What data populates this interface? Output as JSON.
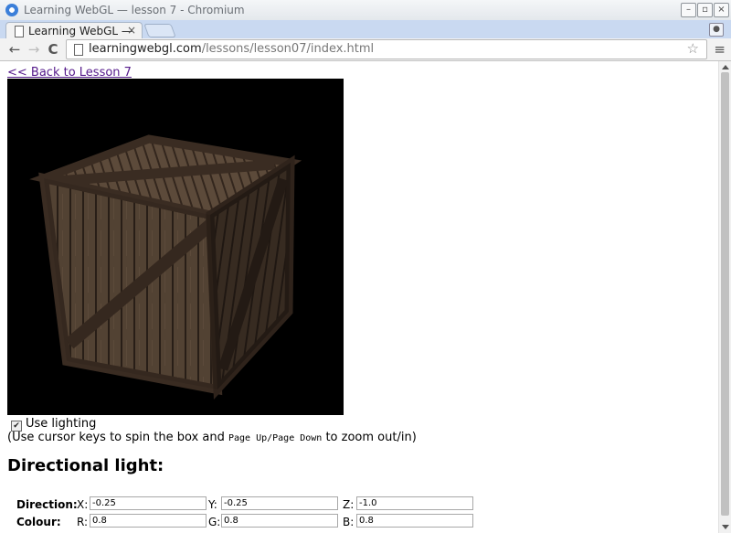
{
  "window": {
    "title": "Learning WebGL — lesson 7 - Chromium",
    "controls": {
      "minimize": "–",
      "maximize": "▫",
      "close": "×"
    }
  },
  "tab": {
    "title": "Learning WebGL — ",
    "close": "×"
  },
  "toolbar": {
    "back": "←",
    "forward": "→",
    "reload": "C",
    "url_host": "learningwebgl.com",
    "url_path": "/lessons/lesson07/index.html",
    "bookmark": "☆",
    "menu": "≡"
  },
  "page": {
    "back_link": "<< Back to Lesson 7",
    "use_lighting_label": "Use lighting",
    "use_lighting_checked": true,
    "hint_prefix": "(Use cursor keys to spin the box and ",
    "hint_keys": "Page Up/Page Down",
    "hint_suffix": " to zoom out/in)",
    "directional_heading": "Directional light:",
    "direction": {
      "label": "Direction:",
      "x_label": "X:",
      "x": "-0.25",
      "y_label": "Y:",
      "y": "-0.25",
      "z_label": "Z:",
      "z": "-1.0"
    },
    "colour": {
      "label": "Colour:",
      "r_label": "R:",
      "r": "0.8",
      "g_label": "G:",
      "g": "0.8",
      "b_label": "B:",
      "b": "0.8"
    }
  },
  "colors": {
    "link": "#551a8b",
    "tabstrip": "#c9d9f1",
    "crate_wood": "#5a4838",
    "crate_frame": "#3a2c22"
  }
}
